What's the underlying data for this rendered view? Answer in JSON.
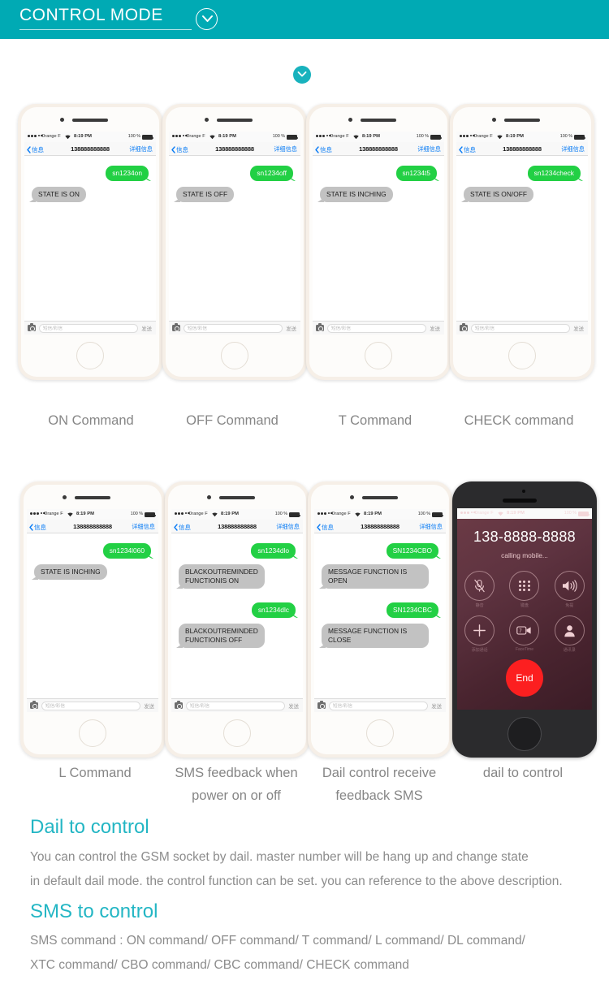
{
  "header": {
    "title": "CONTROL MODE",
    "chevron_icon": "chevron-down-icon"
  },
  "scroll_chevron": {
    "icon": "chevron-down-icon"
  },
  "phone_ui": {
    "status_bar": {
      "carrier": "Orange F",
      "time": "8:19 PM",
      "battery": "100 %",
      "wifi_icon": "wifi-icon",
      "signal_icon": "signal-dots-icon",
      "battery_icon": "battery-full-icon"
    },
    "nav_bar": {
      "back_label": "信息",
      "back_icon": "chevron-left-icon",
      "title": "138888888888",
      "detail_label": "详细信息"
    },
    "input_bar": {
      "camera_icon": "camera-icon",
      "placeholder": "短信/彩信",
      "send_label": "发送"
    }
  },
  "phones": [
    {
      "caption": "ON Command",
      "messages": [
        {
          "dir": "out",
          "text": "sn1234on"
        },
        {
          "dir": "in",
          "text": "STATE IS ON"
        }
      ]
    },
    {
      "caption": "OFF Command",
      "messages": [
        {
          "dir": "out",
          "text": "sn1234off"
        },
        {
          "dir": "in",
          "text": "STATE IS OFF"
        }
      ]
    },
    {
      "caption": "T Command",
      "messages": [
        {
          "dir": "out",
          "text": "sn1234t5"
        },
        {
          "dir": "in",
          "text": "STATE IS INCHING"
        }
      ]
    },
    {
      "caption": "CHECK command",
      "messages": [
        {
          "dir": "out",
          "text": "sn1234check"
        },
        {
          "dir": "in",
          "text": "STATE IS ON/OFF"
        }
      ]
    },
    {
      "caption": "L Command",
      "messages": [
        {
          "dir": "out",
          "text": "sn1234l060"
        },
        {
          "dir": "in",
          "text": "STATE IS INCHING"
        }
      ]
    },
    {
      "caption": "SMS feedback when\npower on or off",
      "messages": [
        {
          "dir": "out",
          "text": "sn1234dlo"
        },
        {
          "dir": "in",
          "text": "BLACKOUTREMINDED\nFUNCTIONIS ON"
        },
        {
          "dir": "out",
          "text": "sn1234dlc"
        },
        {
          "dir": "in",
          "text": "BLACKOUTREMINDED\nFUNCTIONIS OFF"
        }
      ]
    },
    {
      "caption": "Dail control receive\nfeedback SMS",
      "messages": [
        {
          "dir": "out",
          "text": "SN1234CBO"
        },
        {
          "dir": "in",
          "text": "MESSAGE FUNCTION IS OPEN"
        },
        {
          "dir": "out",
          "text": "SN1234CBC"
        },
        {
          "dir": "in",
          "text": "MESSAGE FUNCTION IS CLOSE"
        }
      ]
    }
  ],
  "call_phone": {
    "caption": "dail to control",
    "number": "138-8888-8888",
    "status_text": "calling mobile...",
    "end_label": "End",
    "keys": [
      {
        "icon": "mute-microphone-icon",
        "label": "静音"
      },
      {
        "icon": "keypad-icon",
        "label": "键盘"
      },
      {
        "icon": "speaker-icon",
        "label": "免提"
      },
      {
        "icon": "add-call-icon",
        "label": "添加通话"
      },
      {
        "icon": "facetime-icon",
        "label": "FaceTime"
      },
      {
        "icon": "contacts-icon",
        "label": "通讯录"
      }
    ]
  },
  "sections": [
    {
      "title": "Dail to control",
      "lines": [
        "You can control the GSM socket  by dail. master  number will be hang up and change  state",
        "in default dail mode. the control function can be set. you can reference to the above description."
      ]
    },
    {
      "title": "SMS to control",
      "lines": [
        "SMS  command :   ON command/ OFF command/ T command/ L command/ DL command/",
        " XTC command/ CBO command/ CBC command/ CHECK command"
      ]
    }
  ],
  "colors": {
    "brand_teal": "#00aab4",
    "section_title": "#23b6c4",
    "bubble_out": "#22d044",
    "bubble_in": "#c2c2c2",
    "end_button": "#fc1f20"
  }
}
